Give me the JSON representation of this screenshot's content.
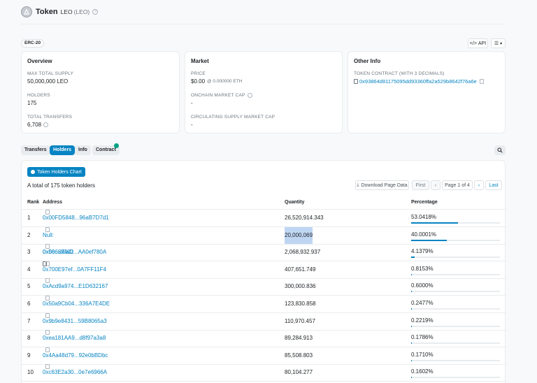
{
  "header": {
    "title": "Token",
    "name": "LEO",
    "symbol": "(LEO)"
  },
  "badge": "ERC-20",
  "toolbar": {
    "api_label": "API"
  },
  "overview": {
    "title": "Overview",
    "max_supply_label": "MAX TOTAL SUPPLY",
    "max_supply_value": "50,000,000 LEO",
    "holders_label": "HOLDERS",
    "holders_value": "175",
    "transfers_label": "TOTAL TRANSFERS",
    "transfers_value": "6,708"
  },
  "market": {
    "title": "Market",
    "price_label": "PRICE",
    "price_value": "$0.00",
    "price_eth": "@ 0.000000 ETH",
    "onchain_cap_label": "ONCHAIN MARKET CAP",
    "onchain_cap_value": "-",
    "circ_cap_label": "CIRCULATING SUPPLY MARKET CAP",
    "circ_cap_value": "-"
  },
  "other_info": {
    "title": "Other Info",
    "contract_label": "TOKEN CONTRACT (WITH 3 DECIMALS)",
    "contract_value": "0x93864d81175095dd93360ffa2a529b8642f76a6e"
  },
  "tabs": [
    {
      "label": "Transfers"
    },
    {
      "label": "Holders"
    },
    {
      "label": "Info"
    },
    {
      "label": "Contract"
    }
  ],
  "holders": {
    "chart_button": "Token Holders Chart",
    "total_text": "A total of 175 token holders",
    "download_label": "Download Page Data",
    "pager": {
      "first": "First",
      "prev": "‹",
      "page": "Page 1 of 4",
      "next": "›",
      "last": "Last"
    },
    "columns": {
      "rank": "Rank",
      "address": "Address",
      "quantity": "Quantity",
      "percentage": "Percentage"
    },
    "rows": [
      {
        "rank": "1",
        "address": "0x00FD5848...96aB7D7d1",
        "quantity": "26,520,914.343",
        "percentage": "53.0418%",
        "pct": 53.0418
      },
      {
        "rank": "2",
        "address": "Null: 0x00...dEaD",
        "quantity": "20,000,069",
        "percentage": "40.0001%",
        "pct": 40.0001
      },
      {
        "rank": "3",
        "address": "0x56687402...AA0ef780A",
        "quantity": "2,068,932.937",
        "percentage": "4.1379%",
        "pct": 4.1379
      },
      {
        "rank": "4",
        "address": "0x700E97ef...0A7FF11F4",
        "quantity": "407,651.749",
        "percentage": "0.8153%",
        "pct": 0.8153
      },
      {
        "rank": "5",
        "address": "0xAcd9a974...E1D632167",
        "quantity": "300,000.836",
        "percentage": "0.6000%",
        "pct": 0.6
      },
      {
        "rank": "6",
        "address": "0x50a9Cb04...336A7E4DE",
        "quantity": "123,830.858",
        "percentage": "0.2477%",
        "pct": 0.2477
      },
      {
        "rank": "7",
        "address": "0x9b9e8431...59B8065a3",
        "quantity": "110,970.457",
        "percentage": "0.2219%",
        "pct": 0.2219
      },
      {
        "rank": "8",
        "address": "0xea181AA9...d8f97a3a8",
        "quantity": "89,284.913",
        "percentage": "0.1786%",
        "pct": 0.1786
      },
      {
        "rank": "9",
        "address": "0x4Aa48d79...92e0bBDbc",
        "quantity": "85,508.803",
        "percentage": "0.1710%",
        "pct": 0.171
      },
      {
        "rank": "10",
        "address": "0xc63E2a30...0e7e6966A",
        "quantity": "80,104.277",
        "percentage": "0.1602%",
        "pct": 0.1602
      }
    ]
  }
}
